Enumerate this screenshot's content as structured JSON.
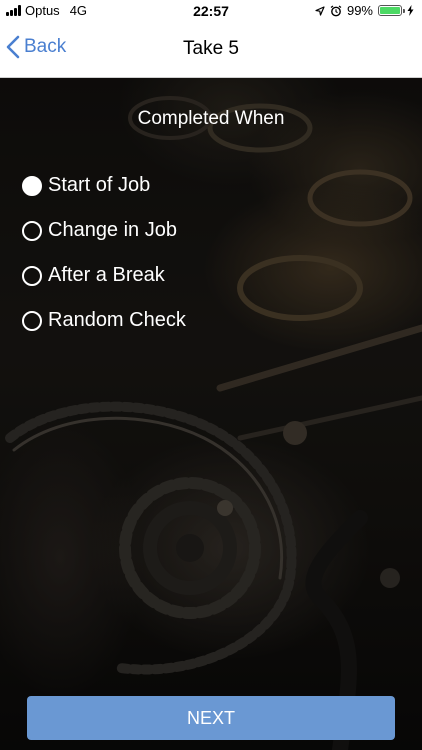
{
  "status_bar": {
    "carrier": "Optus",
    "network": "4G",
    "time": "22:57",
    "battery_percent": "99%",
    "battery_level": 0.99,
    "icons": [
      "signal-icon",
      "location-icon",
      "alarm-icon",
      "battery-icon",
      "charging-icon"
    ]
  },
  "nav": {
    "back_label": "Back",
    "title": "Take 5"
  },
  "form": {
    "section_title": "Completed When",
    "options": [
      {
        "label": "Start of Job",
        "selected": true
      },
      {
        "label": "Change in Job",
        "selected": false
      },
      {
        "label": "After a Break",
        "selected": false
      },
      {
        "label": "Random Check",
        "selected": false
      }
    ]
  },
  "footer": {
    "next_label": "NEXT"
  },
  "colors": {
    "accent": "#4a7fd0",
    "button": "#6a98d3",
    "battery": "#4cd964"
  }
}
